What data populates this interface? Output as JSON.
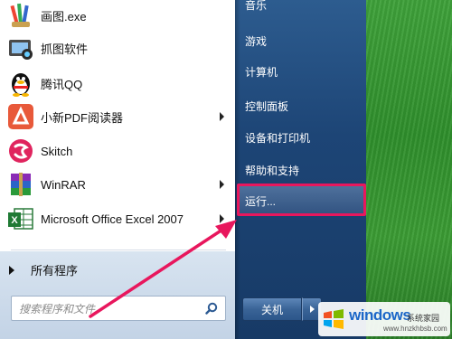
{
  "start_menu": {
    "programs": [
      {
        "label": "画图.exe",
        "icon": "paint-icon"
      },
      {
        "label": "抓图软件",
        "icon": "screenshot-tool-icon"
      },
      {
        "label": "腾讯QQ",
        "icon": "qq-penguin-icon"
      },
      {
        "label": "小新PDF阅读器",
        "icon": "pdf-reader-icon",
        "has_submenu": true
      },
      {
        "label": "Skitch",
        "icon": "skitch-icon"
      },
      {
        "label": "WinRAR",
        "icon": "winrar-icon",
        "has_submenu": true
      },
      {
        "label": "Microsoft Office Excel 2007",
        "icon": "excel-icon",
        "has_submenu": true
      }
    ],
    "all_programs_label": "所有程序",
    "search_placeholder": "搜索程序和文件",
    "right_links": [
      {
        "label": "音乐"
      },
      {
        "label": "游戏"
      },
      {
        "label": "计算机"
      },
      {
        "label": "控制面板"
      },
      {
        "label": "设备和打印机"
      },
      {
        "label": "帮助和支持"
      }
    ],
    "run_label": "运行...",
    "shutdown_label": "关机"
  },
  "watermark": {
    "brand": "windows",
    "sub": "系统家园",
    "url": "www.hnzkhbsb.com"
  },
  "colors": {
    "highlight": "#e8175d",
    "arrow": "#e8175d",
    "right_pane": "#1d4576"
  }
}
